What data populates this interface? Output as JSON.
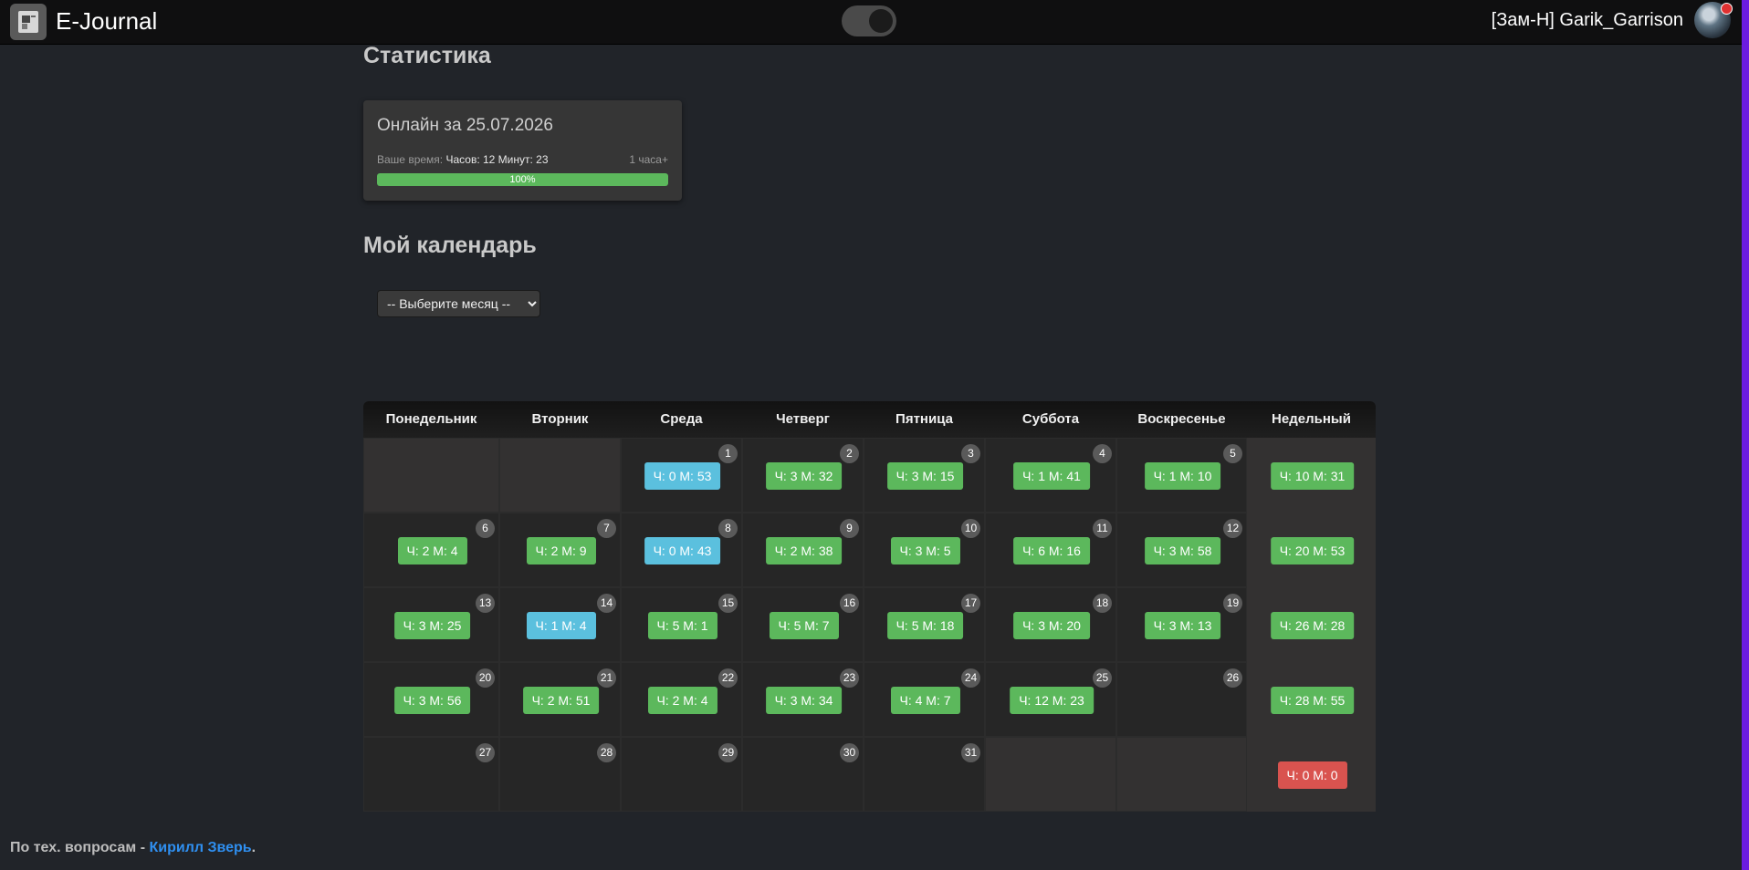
{
  "app": {
    "brand": "E-Journal",
    "username": "[Зам-Н] Garik_Garrison"
  },
  "icons": {
    "logo": "journal-logo-icon",
    "avatar": "user-avatar",
    "toggle": "theme-toggle"
  },
  "stats": {
    "heading": "Статистика",
    "card_title": "Онлайн за 25.07.2026",
    "time_label": "Ваше время:",
    "time_value": "Часов: 12 Минут: 23",
    "goal": "1 часа+",
    "progress_percent": 100,
    "progress_label": "100%"
  },
  "calendar": {
    "heading": "Мой календарь",
    "month_select": {
      "selected": "-- Выберите месяц --"
    },
    "headers": [
      "Понедельник",
      "Вторник",
      "Среда",
      "Четверг",
      "Пятница",
      "Суббота",
      "Воскресенье",
      "Недельный"
    ],
    "weeks": [
      {
        "days": [
          null,
          null,
          {
            "n": "1",
            "t": "Ч: 0 М: 53",
            "s": "info"
          },
          {
            "n": "2",
            "t": "Ч: 3 М: 32",
            "s": "success"
          },
          {
            "n": "3",
            "t": "Ч: 3 М: 15",
            "s": "success"
          },
          {
            "n": "4",
            "t": "Ч: 1 М: 41",
            "s": "success"
          },
          {
            "n": "5",
            "t": "Ч: 1 М: 10",
            "s": "success"
          }
        ],
        "total": {
          "t": "Ч: 10 М: 31",
          "s": "success"
        }
      },
      {
        "days": [
          {
            "n": "6",
            "t": "Ч: 2 М: 4",
            "s": "success"
          },
          {
            "n": "7",
            "t": "Ч: 2 М: 9",
            "s": "success"
          },
          {
            "n": "8",
            "t": "Ч: 0 М: 43",
            "s": "info"
          },
          {
            "n": "9",
            "t": "Ч: 2 М: 38",
            "s": "success"
          },
          {
            "n": "10",
            "t": "Ч: 3 М: 5",
            "s": "success"
          },
          {
            "n": "11",
            "t": "Ч: 6 М: 16",
            "s": "success"
          },
          {
            "n": "12",
            "t": "Ч: 3 М: 58",
            "s": "success"
          }
        ],
        "total": {
          "t": "Ч: 20 М: 53",
          "s": "success"
        }
      },
      {
        "days": [
          {
            "n": "13",
            "t": "Ч: 3 М: 25",
            "s": "success"
          },
          {
            "n": "14",
            "t": "Ч: 1 М: 4",
            "s": "info"
          },
          {
            "n": "15",
            "t": "Ч: 5 М: 1",
            "s": "success"
          },
          {
            "n": "16",
            "t": "Ч: 5 М: 7",
            "s": "success"
          },
          {
            "n": "17",
            "t": "Ч: 5 М: 18",
            "s": "success"
          },
          {
            "n": "18",
            "t": "Ч: 3 М: 20",
            "s": "success"
          },
          {
            "n": "19",
            "t": "Ч: 3 М: 13",
            "s": "success"
          }
        ],
        "total": {
          "t": "Ч: 26 М: 28",
          "s": "success"
        }
      },
      {
        "days": [
          {
            "n": "20",
            "t": "Ч: 3 М: 56",
            "s": "success"
          },
          {
            "n": "21",
            "t": "Ч: 2 М: 51",
            "s": "success"
          },
          {
            "n": "22",
            "t": "Ч: 2 М: 4",
            "s": "success"
          },
          {
            "n": "23",
            "t": "Ч: 3 М: 34",
            "s": "success"
          },
          {
            "n": "24",
            "t": "Ч: 4 М: 7",
            "s": "success"
          },
          {
            "n": "25",
            "t": "Ч: 12 М: 23",
            "s": "success"
          },
          {
            "n": "26",
            "t": "",
            "s": ""
          }
        ],
        "total": {
          "t": "Ч: 28 М: 55",
          "s": "success"
        }
      },
      {
        "days": [
          {
            "n": "27",
            "t": "",
            "s": ""
          },
          {
            "n": "28",
            "t": "",
            "s": ""
          },
          {
            "n": "29",
            "t": "",
            "s": ""
          },
          {
            "n": "30",
            "t": "",
            "s": ""
          },
          {
            "n": "31",
            "t": "",
            "s": ""
          },
          null,
          null
        ],
        "total": {
          "t": "Ч: 0 М: 0",
          "s": "danger"
        }
      }
    ]
  },
  "colors": {
    "success": "#5cb85c",
    "info": "#5bc0de",
    "danger": "#d9534f"
  },
  "footer": {
    "text": "По тех. вопросам - ",
    "link": "Кирилл Зверь",
    "end": "."
  }
}
